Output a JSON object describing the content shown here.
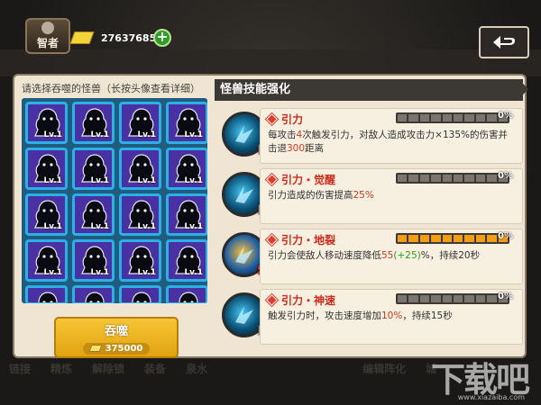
{
  "top_bar": {
    "avatar_label": "智者",
    "gold_amount": "27637685",
    "add_label": "+"
  },
  "background_tabs": [
    "链接",
    "精炼",
    "解除锁",
    "装备",
    "泉水",
    "",
    "",
    "",
    "编辑阵化",
    "城"
  ],
  "left": {
    "hint": "请选择吞噬的怪兽（长按头像查看详细）",
    "monsters": [
      {
        "level": "Lv.1"
      },
      {
        "level": "Lv.1"
      },
      {
        "level": "Lv.1"
      },
      {
        "level": "Lv.1"
      },
      {
        "level": "Lv.1"
      },
      {
        "level": "Lv.1"
      },
      {
        "level": "Lv.1"
      },
      {
        "level": "Lv.1"
      },
      {
        "level": "Lv.1"
      },
      {
        "level": "Lv.1"
      },
      {
        "level": "Lv.1"
      },
      {
        "level": "Lv.1"
      },
      {
        "level": "Lv.1"
      },
      {
        "level": "Lv.1"
      },
      {
        "level": "Lv.1"
      },
      {
        "level": "Lv.1"
      },
      {
        "level": ""
      },
      {
        "level": ""
      },
      {
        "level": ""
      },
      {
        "level": ""
      }
    ],
    "devour_button": {
      "label": "吞噬",
      "cost": "375000"
    }
  },
  "right": {
    "header": "怪兽技能强化",
    "skills": [
      {
        "name": "引力",
        "grade": "E",
        "percent": "0%",
        "progress": 0,
        "desc": [
          "每攻击",
          "4",
          "次触发引力，对敌人造成攻击力×135%的伤害并击退",
          "300",
          "距离"
        ]
      },
      {
        "name": "引力・觉醒",
        "grade": "E",
        "percent": "0%",
        "progress": 0,
        "desc": [
          "引力造成的伤害提高",
          "25%",
          "",
          "",
          ""
        ]
      },
      {
        "name": "引力・地裂",
        "grade": "S",
        "percent": "0%",
        "progress": 1,
        "desc": [
          "引力会使敌人移动速度降低",
          "55",
          "(+25)",
          "%，持续20秒",
          ""
        ]
      },
      {
        "name": "引力・神速",
        "grade": "E",
        "percent": "0%",
        "progress": 0,
        "desc": [
          "触发引力时，攻击速度增加",
          "10%",
          "，持续15秒",
          "",
          ""
        ]
      }
    ]
  },
  "watermark": {
    "text": "下载吧",
    "url": "www.xiazaiba.com"
  }
}
